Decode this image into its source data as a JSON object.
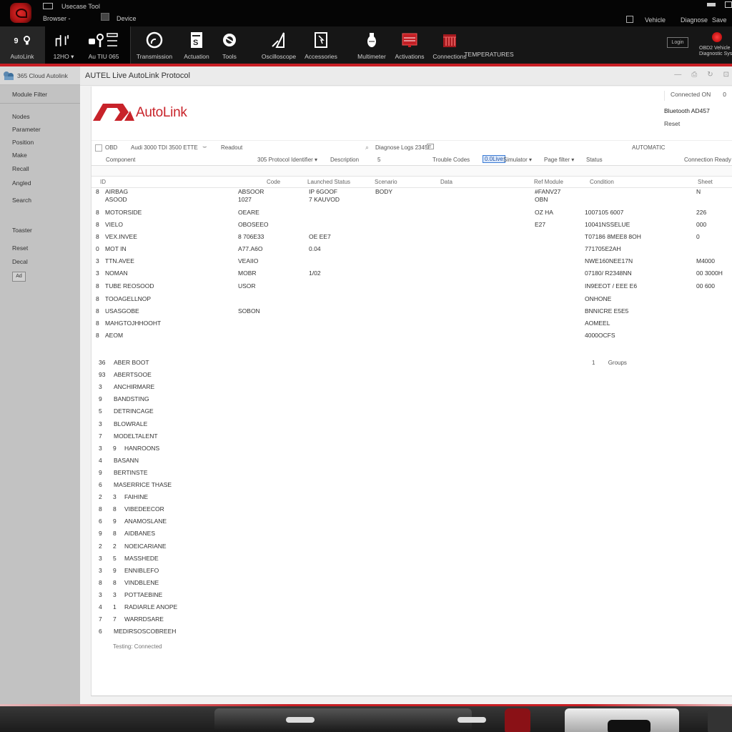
{
  "topbar": {
    "line1": "Usecase  Tool",
    "line2": "Browser  -",
    "line3": "Device",
    "right_items": [
      "Vehicle",
      "Diagnose",
      "Save"
    ]
  },
  "ribbon": {
    "items": [
      {
        "label": "AutoLink",
        "icon": "wrench-icon"
      },
      {
        "label": "12HO  ▾",
        "icon": "plug-icon"
      },
      {
        "label": "Au  TIU 065",
        "icon": "module-icon"
      },
      {
        "label": "Transmission",
        "icon": "gauge-icon"
      },
      {
        "label": "Actuation",
        "icon": "document-icon"
      },
      {
        "label": "Tools",
        "icon": "tire-icon"
      },
      {
        "label": "Oscilloscope",
        "icon": "probe-icon"
      },
      {
        "label": "Accessories",
        "icon": "cursor-doc-icon"
      },
      {
        "label": "Multimeter",
        "icon": "meter-icon"
      },
      {
        "label": "Activations",
        "icon": "monitor-icon"
      },
      {
        "label": "Connections",
        "icon": "server-icon"
      },
      {
        "label": "TEMPERATURES",
        "icon": ""
      }
    ],
    "login_button": "Login",
    "user": {
      "line1": "OBD2 Vehicle",
      "line2": "Diagnostic System"
    }
  },
  "sidebar": {
    "header": "365 Cloud Autolink",
    "sub_header": "Module Filter",
    "items": [
      "Nodes",
      "Parameter",
      "Position",
      "Make",
      "Recall",
      "Angled",
      "Search",
      "Toaster",
      "Reset",
      "Decal"
    ],
    "button": "Ad"
  },
  "window": {
    "title": "AUTEL Live AutoLink Protocol",
    "brand": "AutoLink",
    "info_line1": "Connected  ON",
    "info_line1_extra": "0",
    "info_line2": "Bluetooth AD457",
    "info_line3": "Reset"
  },
  "toolbar1": {
    "left_icon_label": "OBD",
    "vin": "Audi 3000 TDI 3500 ETTE",
    "mode": "Readout",
    "search": "Diagnose Logs 2345E",
    "right": "AUTOMATIC"
  },
  "toolbar2": {
    "col": "Component",
    "dropdown1": "305 Protocol Identifier ▾",
    "field": "Description",
    "num": "5",
    "field2": "Trouble Codes",
    "selected": "0.0Live",
    "dropdown2": "Simulator ▾",
    "dropdown3": "Page filter ▾",
    "field3": "Status",
    "right": "Connection Ready"
  },
  "table": {
    "headers": [
      "ID",
      "Code",
      "Launched Status",
      "Scenario",
      "Data",
      "Ref Module",
      "Condition",
      "Sheet"
    ],
    "rows": [
      {
        "n": "8",
        "name": "AIRBAG\nASOOD",
        "code": "ABSOOR\n1027",
        "status": "IP 6GOOF\n7 KAUVOD",
        "scenario": "BODY",
        "ref": "#FANV27\nOBN",
        "cond": "",
        "sheet": "N"
      },
      {
        "n": "8",
        "name": "MOTORSIDE",
        "code": "OEARE",
        "status": "",
        "scenario": "",
        "ref": "OZ HA",
        "cond": "1007105 6007",
        "sheet": "226"
      },
      {
        "n": "8",
        "name": "VIELO",
        "code": "OBOSEEO",
        "status": "",
        "scenario": "",
        "ref": "E27",
        "cond": "10041NSSELUE",
        "sheet": "000"
      },
      {
        "n": "8",
        "name": "VEX.INVEE",
        "code": "8 706E33",
        "status": "OE EE7",
        "scenario": "",
        "ref": "",
        "cond": "T07186 8MEE8 8OH",
        "sheet": "0"
      },
      {
        "n": "0",
        "name": "MOT IN",
        "code": "A77.A6O",
        "status": "0.04",
        "scenario": "",
        "ref": "",
        "cond": "771705E2AH",
        "sheet": ""
      },
      {
        "n": "3",
        "name": "TTN.AVEE",
        "code": "VEAIIO",
        "status": "",
        "scenario": "",
        "ref": "",
        "cond": "NWE160NEE17N",
        "sheet": "M4000"
      },
      {
        "n": "3",
        "name": "NOMAN",
        "code": "MOBR",
        "status": "1/02",
        "scenario": "",
        "ref": "",
        "cond": "07180/ R2348NN",
        "sheet": "00 3000H"
      },
      {
        "n": "8",
        "name": "TUBE REOSOOD",
        "code": "USOR",
        "status": "",
        "scenario": "",
        "ref": "",
        "cond": "IN9EEOT / EEE E6",
        "sheet": "00 600"
      },
      {
        "n": "8",
        "name": "TOOAGELLNOP",
        "code": "",
        "status": "",
        "scenario": "",
        "ref": "",
        "cond": "ONHONE",
        "sheet": ""
      },
      {
        "n": "8",
        "name": "USASGOBE",
        "code": "SOBON",
        "status": "",
        "scenario": "",
        "ref": "",
        "cond": "BNNICRE E5E5",
        "sheet": ""
      },
      {
        "n": "8",
        "name": "MAHGTOJHHOOHT",
        "code": "",
        "status": "",
        "scenario": "",
        "ref": "",
        "cond": "AOMEEL",
        "sheet": ""
      },
      {
        "n": "8",
        "name": "AEOM",
        "code": "",
        "status": "",
        "scenario": "",
        "ref": "",
        "cond": "4000OCFS",
        "sheet": ""
      }
    ]
  },
  "pager": {
    "page": "1",
    "label": "Groups"
  },
  "list2": {
    "rows": [
      {
        "a": "36",
        "b": "",
        "name": "ABER BOOT"
      },
      {
        "a": "93",
        "b": "",
        "name": "ABERTSOOE"
      },
      {
        "a": "3",
        "b": "",
        "name": "ANCHIRMARE"
      },
      {
        "a": "9",
        "b": "",
        "name": "BANDSTING"
      },
      {
        "a": "5",
        "b": "",
        "name": "DETRINCAGE"
      },
      {
        "a": "3",
        "b": "",
        "name": "BLOWRALE"
      },
      {
        "a": "7",
        "b": "",
        "name": "MODELTALENT"
      },
      {
        "a": "3",
        "b": "9",
        "name": "HANROONS"
      },
      {
        "a": "4",
        "b": "",
        "name": "BASANN"
      },
      {
        "a": "9",
        "b": "",
        "name": "BERTINSTE"
      },
      {
        "a": "6",
        "b": "",
        "name": "MASERRICE THASE"
      },
      {
        "a": "2",
        "b": "3",
        "name": "FAIHINE"
      },
      {
        "a": "8",
        "b": "8",
        "name": "VIBEDEECOR"
      },
      {
        "a": "6",
        "b": "9",
        "name": "ANAMOSLANE"
      },
      {
        "a": "9",
        "b": "8",
        "name": "AIDBANES"
      },
      {
        "a": "2",
        "b": "2",
        "name": "NOEICARIANE"
      },
      {
        "a": "3",
        "b": "5",
        "name": "MASSHEDE"
      },
      {
        "a": "3",
        "b": "9",
        "name": "ENNIBLEFO"
      },
      {
        "a": "8",
        "b": "8",
        "name": "VINDBLENE"
      },
      {
        "a": "3",
        "b": "3",
        "name": "POTTAEBINE"
      },
      {
        "a": "4",
        "b": "1",
        "name": "RADIARLE ANOPE"
      },
      {
        "a": "7",
        "b": "7",
        "name": "WARRDSARE"
      },
      {
        "a": "6",
        "b": "",
        "name": "MEDIRSOSCOBREEH"
      }
    ],
    "footer": "Testing: Connected"
  }
}
